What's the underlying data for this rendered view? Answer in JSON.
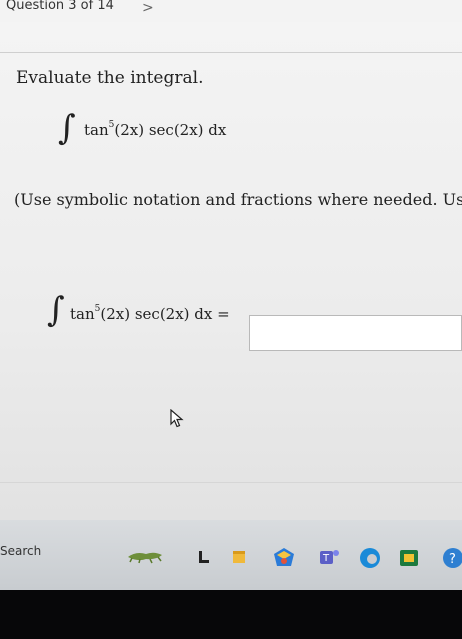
{
  "header": {
    "question_label": "Question 3 of 14",
    "next_symbol": ">"
  },
  "main": {
    "prompt": "Evaluate the integral.",
    "integral": {
      "sign": "∫",
      "tan_label": "tan",
      "tan_exp": "5",
      "rest": "(2x) sec(2x) dx"
    },
    "instructions": "(Use symbolic notation and fractions where needed. Use C f",
    "answer": {
      "sign": "∫",
      "tan_label": "tan",
      "tan_exp": "5",
      "rest": "(2x) sec(2x) dx =",
      "value": ""
    }
  },
  "taskbar": {
    "search_label": "Search",
    "icons": [
      "lizard-widget-icon",
      "task-view-icon",
      "file-explorer-icon",
      "store-icon",
      "teams-icon",
      "edge-icon",
      "office-icon",
      "help-icon"
    ]
  }
}
